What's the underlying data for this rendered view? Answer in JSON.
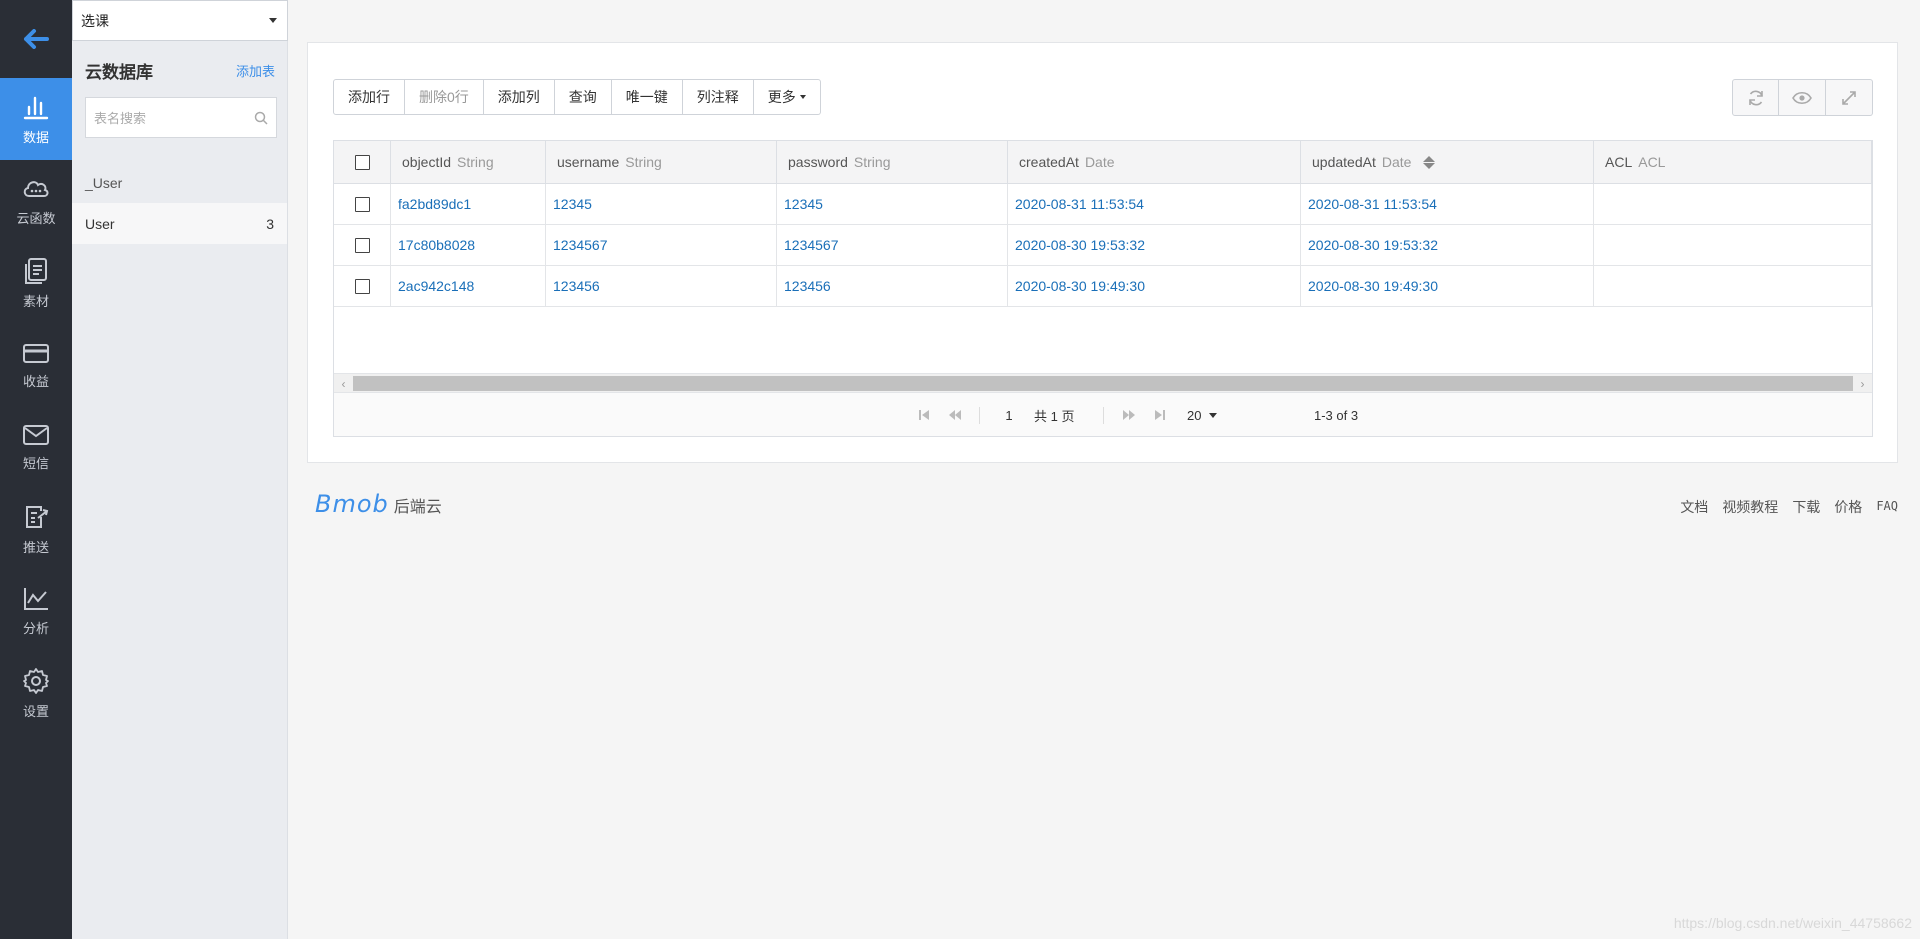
{
  "rail": {
    "items": [
      {
        "label": "数据",
        "icon": "bar-chart-icon"
      },
      {
        "label": "云函数",
        "icon": "cloud-icon"
      },
      {
        "label": "素材",
        "icon": "document-icon"
      },
      {
        "label": "收益",
        "icon": "card-icon"
      },
      {
        "label": "短信",
        "icon": "mail-icon"
      },
      {
        "label": "推送",
        "icon": "push-icon"
      },
      {
        "label": "分析",
        "icon": "line-chart-icon"
      },
      {
        "label": "设置",
        "icon": "gear-icon"
      }
    ]
  },
  "sidebar": {
    "app_select": "选课",
    "title": "云数据库",
    "add_table": "添加表",
    "search_placeholder": "表名搜索",
    "tables": [
      {
        "name": "_User",
        "count": ""
      },
      {
        "name": "User",
        "count": "3"
      }
    ]
  },
  "toolbar": {
    "buttons": [
      "添加行",
      "删除0行",
      "添加列",
      "查询",
      "唯一键",
      "列注释",
      "更多"
    ]
  },
  "grid": {
    "columns": [
      {
        "name": "objectId",
        "type": "String"
      },
      {
        "name": "username",
        "type": "String"
      },
      {
        "name": "password",
        "type": "String"
      },
      {
        "name": "createdAt",
        "type": "Date"
      },
      {
        "name": "updatedAt",
        "type": "Date"
      },
      {
        "name": "ACL",
        "type": "ACL"
      }
    ],
    "rows": [
      {
        "objectId": "fa2bd89dc1",
        "username": "12345",
        "password": "12345",
        "createdAt": "2020-08-31 11:53:54",
        "updatedAt": "2020-08-31 11:53:54",
        "ACL": ""
      },
      {
        "objectId": "17c80b8028",
        "username": "1234567",
        "password": "1234567",
        "createdAt": "2020-08-30 19:53:32",
        "updatedAt": "2020-08-30 19:53:32",
        "ACL": ""
      },
      {
        "objectId": "2ac942c148",
        "username": "123456",
        "password": "123456",
        "createdAt": "2020-08-30 19:49:30",
        "updatedAt": "2020-08-30 19:49:30",
        "ACL": ""
      }
    ]
  },
  "pager": {
    "page": "1",
    "total_pages": "共 1 页",
    "page_size": "20",
    "range": "1-3 of 3"
  },
  "footer": {
    "brand": "Bmob",
    "brand_suffix": "后端云",
    "links": [
      "文档",
      "视频教程",
      "下载",
      "价格",
      "FAQ"
    ]
  },
  "watermark": "https://blog.csdn.net/weixin_44758662",
  "colors": {
    "accent": "#3d8fe8",
    "rail_bg": "#2a2e36",
    "link": "#1a6fb8"
  }
}
